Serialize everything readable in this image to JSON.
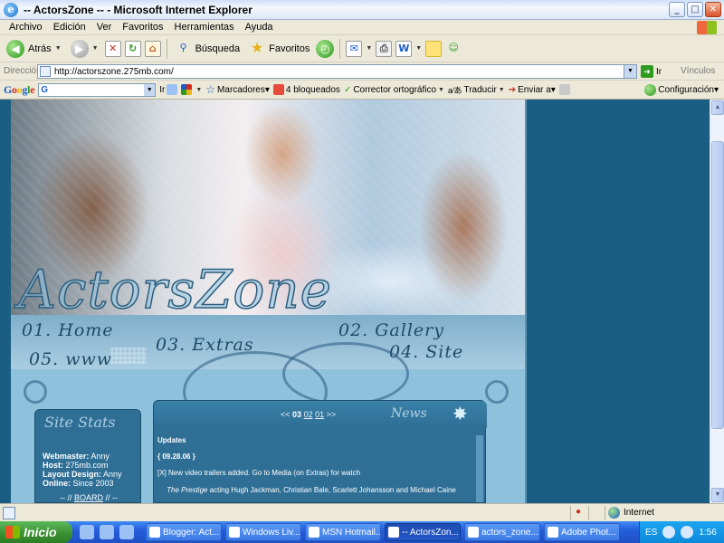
{
  "window": {
    "title": "-- ActorsZone -- - Microsoft Internet Explorer",
    "min": "_",
    "max": "□",
    "close": "✕"
  },
  "menu": [
    "Archivo",
    "Edición",
    "Ver",
    "Favoritos",
    "Herramientas",
    "Ayuda"
  ],
  "toolbar": {
    "back": "Atrás",
    "search": "Búsqueda",
    "favorites": "Favoritos"
  },
  "address": {
    "label": "Dirección",
    "url": "http://actorszone.275mb.com/",
    "go": "Ir",
    "links": "Vínculos"
  },
  "google": {
    "logo": [
      "G",
      "o",
      "o",
      "g",
      "l",
      "e"
    ],
    "search_prefix": "G",
    "go": "Ir",
    "bookmarks": "Marcadores▾",
    "blocked": "4 bloqueados",
    "spell": "Corrector ortográfico",
    "translate": "Traducir",
    "send": "Enviar a▾",
    "settings": "Configuración▾"
  },
  "site": {
    "logo": "ActorsZone",
    "nav": [
      "01. Home",
      "02. Gallery",
      "03. Extras",
      "04. Site",
      "05. www"
    ],
    "stats": {
      "title": "Site Stats",
      "rows": [
        {
          "k": "Webmaster:",
          "v": "Anny"
        },
        {
          "k": "Host:",
          "v": "275mb.com"
        },
        {
          "k": "Layout Design:",
          "v": "Anny"
        },
        {
          "k": "Online:",
          "v": "Since 2003"
        }
      ],
      "board_pre": "-- //",
      "board": "BOARD",
      "board_post": "// --"
    },
    "news": {
      "title": "News",
      "pager_prev": "<<",
      "pager_current": "03",
      "pager_02": "02",
      "pager_01": "01",
      "pager_next": ">>",
      "heading": "Updates",
      "date": "{ 09.28.06 }",
      "item": "[X] New video trailers added. Go to Media (on Extras) for watch",
      "movie": "The Prestige",
      "cast": "acting Hugh Jackman, Christian Bale, Scarlett Johansson and Michael Caine"
    }
  },
  "status": {
    "zone": "Internet"
  },
  "taskbar": {
    "start": "Inicio",
    "tasks": [
      "Blogger: Act...",
      "Windows Liv...",
      "MSN Hotmail...",
      "-- ActorsZon...",
      "actors_zone...",
      "Adobe Phot..."
    ],
    "lang": "ES",
    "clock": "1:56"
  },
  "colors": {
    "page_bg": "#1A5E83",
    "panel": "#2F6F96",
    "site_bg": "#8BBCD6"
  }
}
